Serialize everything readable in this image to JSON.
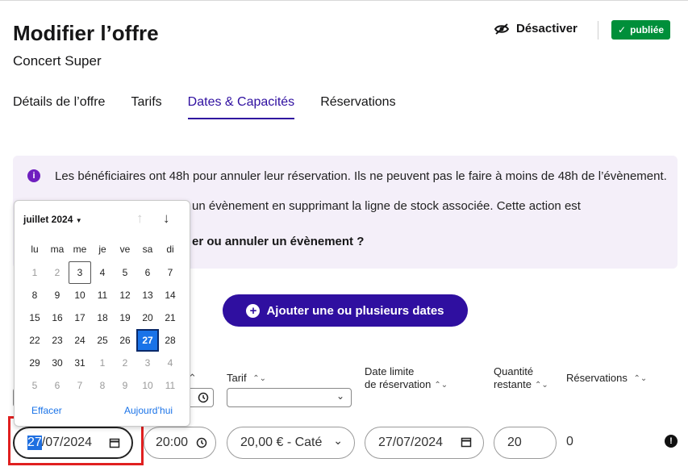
{
  "header": {
    "title": "Modifier l’offre",
    "subtitle": "Concert Super",
    "deactivate_label": "Désactiver",
    "status_badge": "publiée",
    "status_color": "#008f3a"
  },
  "tabs": [
    {
      "label": "Détails de l’offre",
      "active": false
    },
    {
      "label": "Tarifs",
      "active": false
    },
    {
      "label": "Dates & Capacités",
      "active": true
    },
    {
      "label": "Réservations",
      "active": false
    }
  ],
  "info": {
    "line1": "Les bénéficiaires ont 48h pour annuler leur réservation. Ils ne peuvent pas le faire à moins de 48h de l’évènement.",
    "line2_visible": "un évènement en supprimant la ligne de stock associée. Cette action est",
    "link_visible": "er ou annuler un évènement ?"
  },
  "add_button_label": "Ajouter une ou plusieurs dates",
  "table": {
    "headers": {
      "tarif": "Tarif",
      "date_limite": [
        "Date limite",
        "de réservation"
      ],
      "quantite": [
        "Quantité",
        "restante"
      ],
      "reservations": "Réservations"
    },
    "row": {
      "date_day": "27",
      "date_rest": "/07/2024",
      "time": "20:00",
      "tarif": "20,00 € - Caté",
      "date_limite": "27/07/2024",
      "quantite": "20",
      "reservations": "0"
    }
  },
  "calendar": {
    "month_label": "juillet 2024",
    "weekdays": [
      "lu",
      "ma",
      "me",
      "je",
      "ve",
      "sa",
      "di"
    ],
    "weeks": [
      [
        [
          "1",
          "other"
        ],
        [
          "2",
          "other"
        ],
        [
          "3",
          "today"
        ],
        [
          "4",
          ""
        ],
        [
          "5",
          ""
        ],
        [
          "6",
          ""
        ],
        [
          "7",
          ""
        ]
      ],
      [
        [
          "8",
          ""
        ],
        [
          "9",
          ""
        ],
        [
          "10",
          ""
        ],
        [
          "11",
          ""
        ],
        [
          "12",
          ""
        ],
        [
          "13",
          ""
        ],
        [
          "14",
          ""
        ]
      ],
      [
        [
          "15",
          ""
        ],
        [
          "16",
          ""
        ],
        [
          "17",
          ""
        ],
        [
          "18",
          ""
        ],
        [
          "19",
          ""
        ],
        [
          "20",
          ""
        ],
        [
          "21",
          ""
        ]
      ],
      [
        [
          "22",
          ""
        ],
        [
          "23",
          ""
        ],
        [
          "24",
          ""
        ],
        [
          "25",
          ""
        ],
        [
          "26",
          ""
        ],
        [
          "27",
          "sel"
        ],
        [
          "28",
          ""
        ]
      ],
      [
        [
          "29",
          ""
        ],
        [
          "30",
          ""
        ],
        [
          "31",
          ""
        ],
        [
          "1",
          "other"
        ],
        [
          "2",
          "other"
        ],
        [
          "3",
          "other"
        ],
        [
          "4",
          "other"
        ]
      ],
      [
        [
          "5",
          "other"
        ],
        [
          "6",
          "other"
        ],
        [
          "7",
          "other"
        ],
        [
          "8",
          "other"
        ],
        [
          "9",
          "other"
        ],
        [
          "10",
          "other"
        ],
        [
          "11",
          "other"
        ]
      ]
    ],
    "clear_label": "Effacer",
    "today_label": "Aujourd’hui"
  },
  "colors": {
    "primary": "#2f0fa0",
    "info_bg": "#f4eff9",
    "info_icon": "#6f1fbf",
    "highlight": "#e02020"
  }
}
